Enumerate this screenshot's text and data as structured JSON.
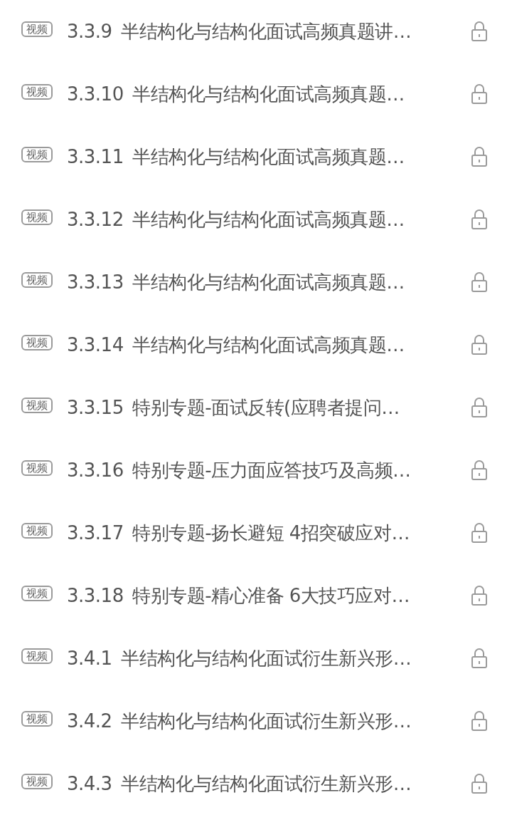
{
  "lessons": [
    {
      "badge": "视频",
      "number": "3.3.9",
      "title": "半结构化与结构化面试高频真题讲…",
      "locked": true
    },
    {
      "badge": "视频",
      "number": "3.3.10",
      "title": "半结构化与结构化面试高频真题…",
      "locked": true
    },
    {
      "badge": "视频",
      "number": "3.3.11",
      "title": "半结构化与结构化面试高频真题…",
      "locked": true
    },
    {
      "badge": "视频",
      "number": "3.3.12",
      "title": "半结构化与结构化面试高频真题…",
      "locked": true
    },
    {
      "badge": "视频",
      "number": "3.3.13",
      "title": "半结构化与结构化面试高频真题…",
      "locked": true
    },
    {
      "badge": "视频",
      "number": "3.3.14",
      "title": "半结构化与结构化面试高频真题…",
      "locked": true
    },
    {
      "badge": "视频",
      "number": "3.3.15",
      "title": "特别专题-面试反转(应聘者提问…",
      "locked": true
    },
    {
      "badge": "视频",
      "number": "3.3.16",
      "title": "特别专题-压力面应答技巧及高频…",
      "locked": true
    },
    {
      "badge": "视频",
      "number": "3.3.17",
      "title": "特别专题-扬长避短 4招突破应对…",
      "locked": true
    },
    {
      "badge": "视频",
      "number": "3.3.18",
      "title": "特别专题-精心准备 6大技巧应对…",
      "locked": true
    },
    {
      "badge": "视频",
      "number": "3.4.1",
      "title": "半结构化与结构化面试衍生新兴形…",
      "locked": true
    },
    {
      "badge": "视频",
      "number": "3.4.2",
      "title": "半结构化与结构化面试衍生新兴形…",
      "locked": true
    },
    {
      "badge": "视频",
      "number": "3.4.3",
      "title": "半结构化与结构化面试衍生新兴形…",
      "locked": true
    }
  ]
}
